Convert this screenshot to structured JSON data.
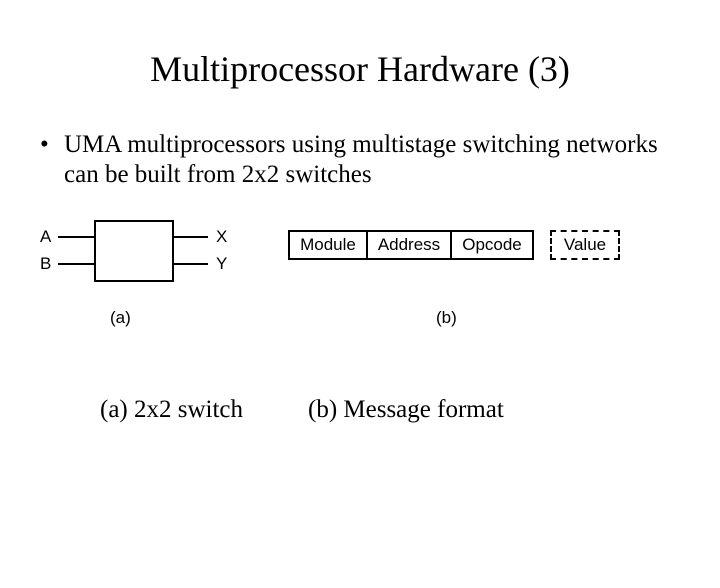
{
  "title": "Multiprocessor Hardware (3)",
  "bullet": "UMA multiprocessors using multistage switching networks can be built from 2x2 switches",
  "switch": {
    "ports": {
      "A": "A",
      "B": "B",
      "X": "X",
      "Y": "Y"
    },
    "label": "(a)"
  },
  "message": {
    "fields": {
      "module": "Module",
      "address": "Address",
      "opcode": "Opcode",
      "value": "Value"
    },
    "label": "(b)"
  },
  "captions": {
    "a": "(a) 2x2 switch",
    "b": "(b) Message format"
  }
}
